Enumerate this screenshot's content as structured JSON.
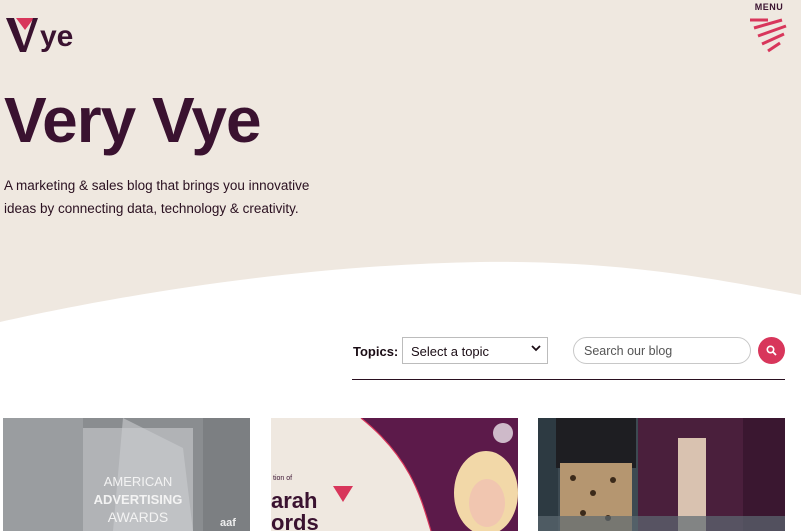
{
  "brand": {
    "name": "Vye",
    "accent_color": "#d8365b",
    "dark_color": "#3a1230"
  },
  "menu": {
    "label": "MENU"
  },
  "hero": {
    "title": "Very Vye",
    "description": "A marketing & sales blog that brings you innovative ideas by connecting data, technology & creativity."
  },
  "filters": {
    "topics_label": "Topics:",
    "topic_select_value": "Select a topic",
    "search_placeholder": "Search our blog"
  },
  "cards": [
    {
      "image_text": [
        "AMERICAN",
        "ADVERTISING",
        "AWARDS"
      ],
      "side_text": "aaf"
    },
    {
      "image_text": [
        "tion of",
        "arah",
        "ords"
      ]
    },
    {
      "image_text": []
    }
  ]
}
